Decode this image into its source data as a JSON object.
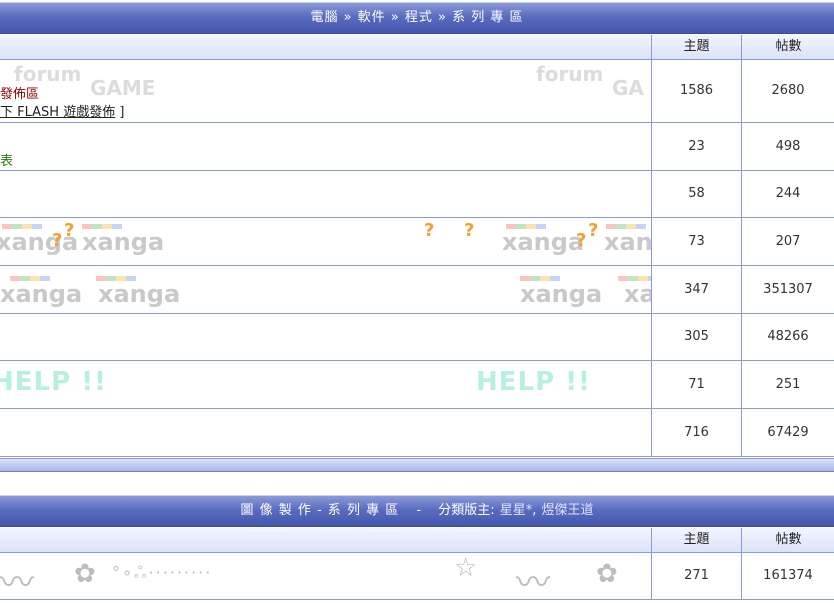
{
  "section1": {
    "breadcrumb": "電腦 » 軟件 » 程式 » 系 列 專 區",
    "col_topics": "主題",
    "col_posts": "帖數",
    "rows": [
      {
        "line1": "發佈區",
        "line2_prefix": "",
        "line2_link": "下 FLASH 遊戲發佈",
        "line2_suffix": " ]",
        "topics": "1586",
        "posts": "2680",
        "watermark": [
          "forum",
          "GAME",
          "forum",
          "GA"
        ]
      },
      {
        "line1": "表",
        "topics": "23",
        "posts": "498"
      },
      {
        "topics": "58",
        "posts": "244"
      },
      {
        "topics": "73",
        "posts": "207",
        "watermark": [
          "xanga",
          "xanga",
          "xanga",
          "xan"
        ]
      },
      {
        "topics": "347",
        "posts": "351307",
        "watermark": [
          "xanga",
          "xanga",
          "xanga",
          "xa"
        ]
      },
      {
        "topics": "305",
        "posts": "48266"
      },
      {
        "topics": "71",
        "posts": "251",
        "watermark": [
          "HELP !!",
          "HELP !!"
        ]
      },
      {
        "topics": "716",
        "posts": "67429"
      }
    ]
  },
  "section2": {
    "title": "圖 像 製 作 - 系 列 專 區",
    "separator": "-",
    "mods_label": "分類版主:",
    "moderators": [
      "星星*",
      "煜傑王道"
    ],
    "col_topics": "主題",
    "col_posts": "帖數",
    "rows": [
      {
        "topics": "271",
        "posts": "161374"
      }
    ]
  },
  "colors": {
    "header": "#5a6cc0",
    "border": "#8b9ad8",
    "subheader": "#dbe3f8"
  }
}
